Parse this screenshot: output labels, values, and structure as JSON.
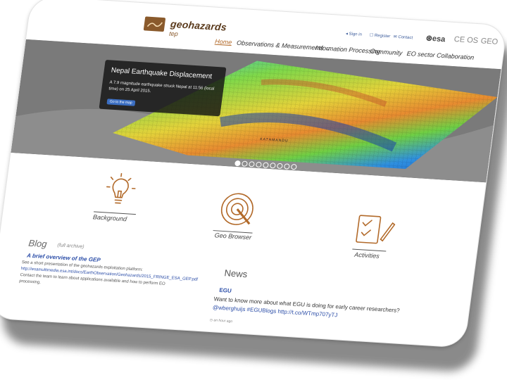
{
  "header": {
    "logo_name": "geohazards",
    "logo_sub": "tep",
    "util_links": [
      {
        "label": "Sign in"
      },
      {
        "label": "Register"
      },
      {
        "label": "Contact"
      }
    ],
    "partners": [
      "esa",
      "CE OS",
      "GEO"
    ],
    "nav": [
      {
        "label": "Home",
        "active": true
      },
      {
        "label": "Observations & Measurements",
        "active": false
      },
      {
        "label": "Information Processing",
        "active": false
      },
      {
        "label": "Community",
        "active": false
      },
      {
        "label": "EO sector Collaboration",
        "active": false
      }
    ]
  },
  "banner": {
    "title": "Nepal Earthquake Displacement",
    "text": "A 7.9 magnitude earthquake struck Nepal at 11:56 (local time) on 25 April 2015.",
    "button": "Go to the map",
    "map_label": "KATHMANDU",
    "slide_count": 9,
    "active_slide": 1
  },
  "features": [
    {
      "label": "Background",
      "icon": "lightbulb-icon"
    },
    {
      "label": "Geo Browser",
      "icon": "target-icon"
    },
    {
      "label": "Activities",
      "icon": "checklist-icon"
    }
  ],
  "blog": {
    "title": "Blog",
    "archive": "(full archive)",
    "post_title": "A brief overview of the GEP",
    "post_text_1": "See a short presentation of the geohazards exploitation platform:",
    "post_link": "http://esamultimedia.esa.int/docs/EarthObservation/Geohazards/2015_FRINGE_ESA_GEP.pdf",
    "post_text_2": "Contact the team to learn about applications available and how to perform EO processing."
  },
  "news": {
    "title": "News",
    "source": "EGU",
    "text_1": "Want to know more about what EGU is doing for early career researchers?",
    "mention": "@wberghuijs",
    "hashtag": "#EGUBlogs",
    "link": "http://t.co/WTmp707yTJ",
    "time": "an hour ago"
  }
}
